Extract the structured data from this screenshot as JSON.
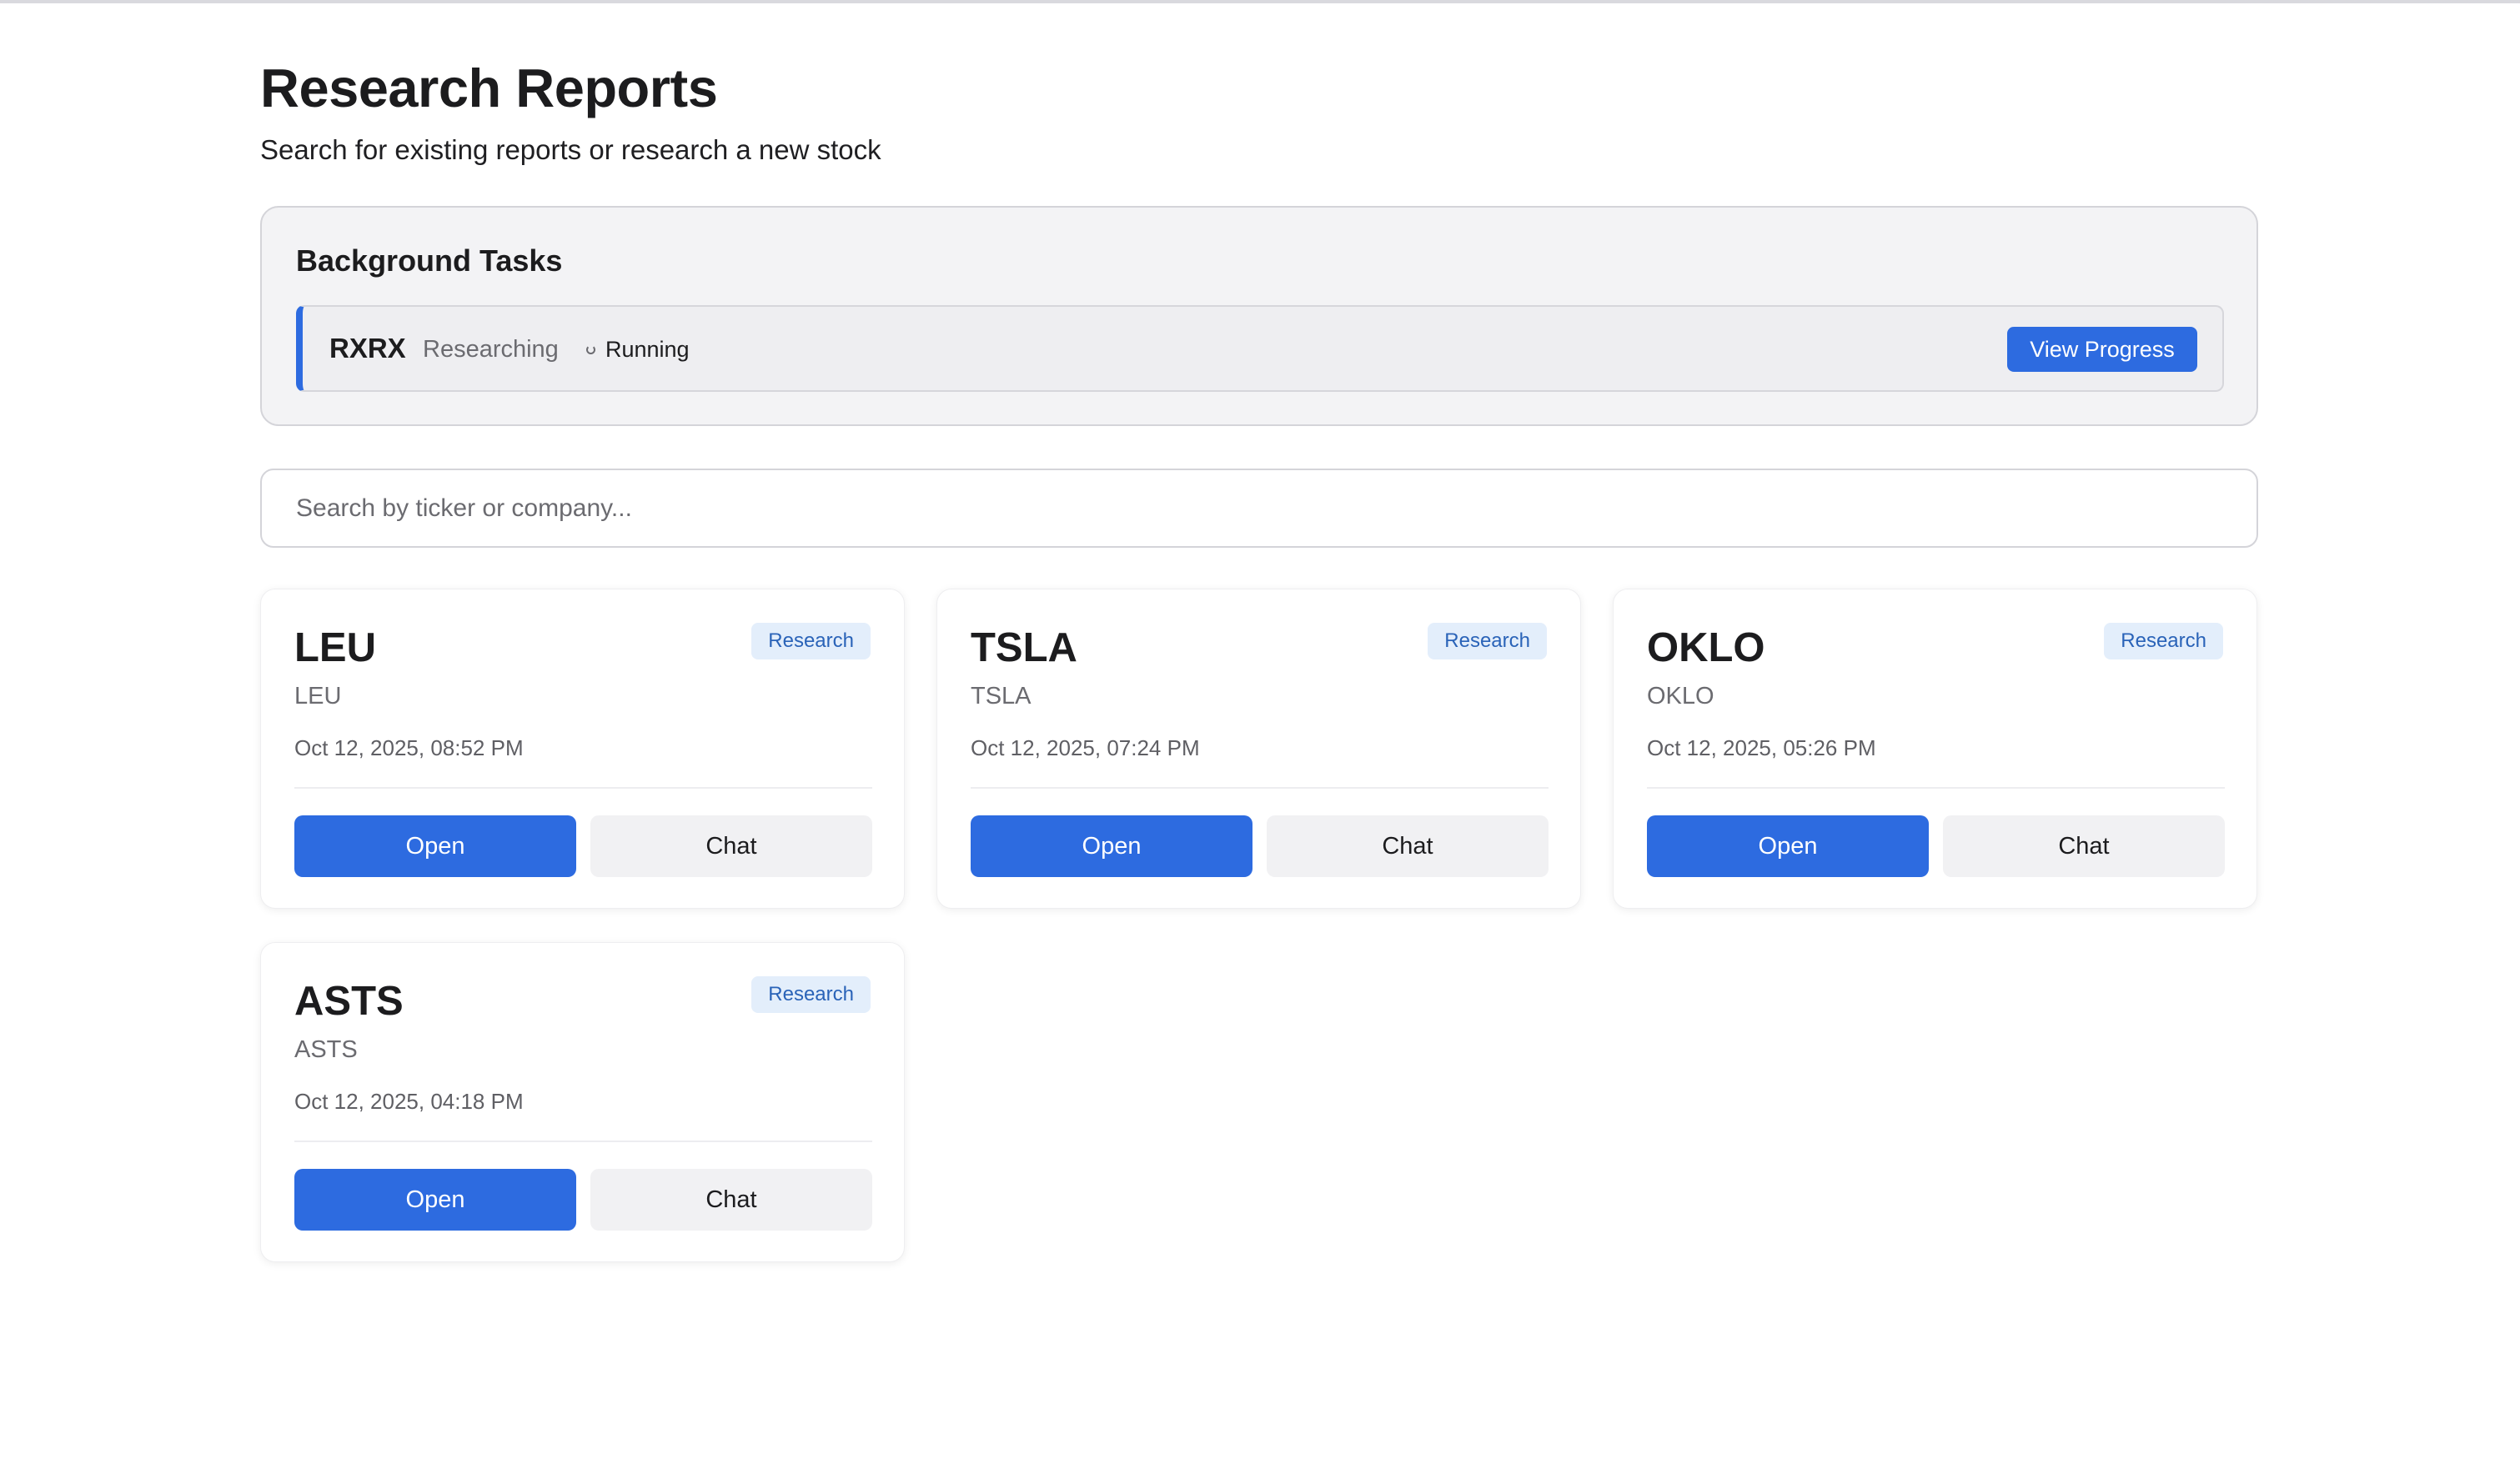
{
  "header": {
    "title": "Research Reports",
    "subtitle": "Search for existing reports or research a new stock"
  },
  "background_tasks": {
    "title": "Background Tasks",
    "tasks": [
      {
        "ticker": "RXRX",
        "activity": "Researching",
        "status": "Running",
        "action_label": "View Progress"
      }
    ]
  },
  "search": {
    "placeholder": "Search by ticker or company...",
    "value": ""
  },
  "reports": [
    {
      "ticker": "LEU",
      "company": "LEU",
      "badge": "Research",
      "date": "Oct 12, 2025, 08:52 PM",
      "open_label": "Open",
      "chat_label": "Chat"
    },
    {
      "ticker": "TSLA",
      "company": "TSLA",
      "badge": "Research",
      "date": "Oct 12, 2025, 07:24 PM",
      "open_label": "Open",
      "chat_label": "Chat"
    },
    {
      "ticker": "OKLO",
      "company": "OKLO",
      "badge": "Research",
      "date": "Oct 12, 2025, 05:26 PM",
      "open_label": "Open",
      "chat_label": "Chat"
    },
    {
      "ticker": "ASTS",
      "company": "ASTS",
      "badge": "Research",
      "date": "Oct 12, 2025, 04:18 PM",
      "open_label": "Open",
      "chat_label": "Chat"
    }
  ],
  "colors": {
    "accent": "#2d6be0",
    "badge_bg": "#e3eefb",
    "badge_text": "#2a63b8",
    "panel_bg": "#f3f3f5",
    "secondary_button_bg": "#f1f1f3"
  }
}
